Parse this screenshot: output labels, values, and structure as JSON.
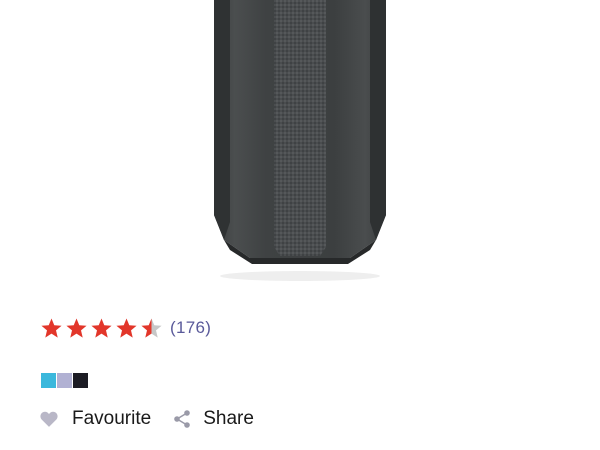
{
  "product": {
    "image_icon": "speaker-image"
  },
  "rating": {
    "value": 4.5,
    "max": 5,
    "count_text": "(176)",
    "star_color": "#e2362a",
    "empty_star_color": "#c7c7c7"
  },
  "swatches": [
    {
      "name": "blue",
      "color": "#3bb8dc"
    },
    {
      "name": "lavender",
      "color": "#b1b1d3"
    },
    {
      "name": "black",
      "color": "#1c1c24"
    }
  ],
  "actions": {
    "favourite_label": "Favourite",
    "favourite_icon": "heart-icon",
    "share_label": "Share",
    "share_icon": "share-icon"
  }
}
